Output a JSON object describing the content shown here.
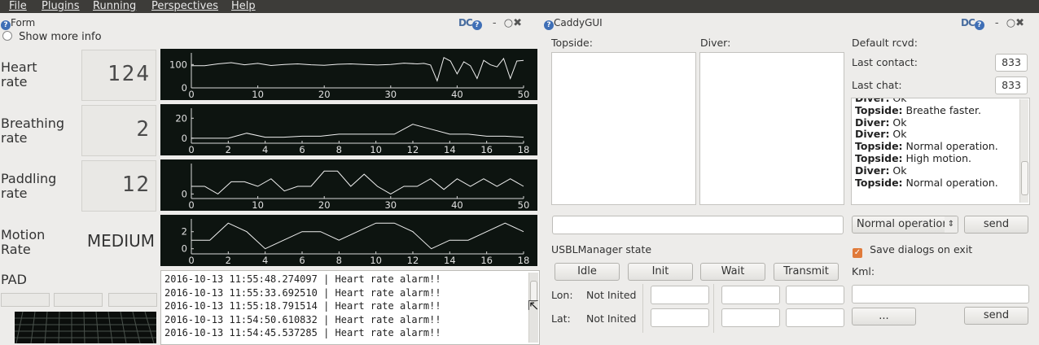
{
  "menu": [
    "File",
    "Plugins",
    "Running",
    "Perspectives",
    "Help"
  ],
  "form": {
    "title": "Form",
    "show_more": "Show more info",
    "rows": [
      {
        "label1": "Heart",
        "label2": "rate",
        "value": "124"
      },
      {
        "label1": "Breathing",
        "label2": "rate",
        "value": "2"
      },
      {
        "label1": "Paddling",
        "label2": "rate",
        "value": "12"
      },
      {
        "label1": "Motion",
        "label2": "Rate",
        "value": "MEDIUM"
      }
    ],
    "pad_label": "PAD",
    "log": [
      "2016-10-13 11:55:48.274097 | Heart rate alarm!!",
      "2016-10-13 11:55:33.692510 | Heart rate alarm!!",
      "2016-10-13 11:55:18.791514 | Heart rate alarm!!",
      "2016-10-13 11:54:50.610832 | Heart rate alarm!!",
      "2016-10-13 11:54:45.537285 | Heart rate alarm!!"
    ]
  },
  "chart_data": [
    {
      "type": "line",
      "name": "heart",
      "xticks": [
        "0",
        "10",
        "20",
        "30",
        "40",
        "50"
      ],
      "yticks": [
        "100",
        "0"
      ],
      "xlim": [
        0,
        50
      ],
      "ylim": [
        0,
        150
      ],
      "x": [
        0,
        2,
        4,
        6,
        8,
        10,
        12,
        14,
        16,
        18,
        20,
        22,
        24,
        26,
        28,
        30,
        32,
        34,
        35,
        36,
        37,
        38,
        39,
        40,
        41,
        42,
        43,
        44,
        45,
        46,
        47,
        48,
        49,
        50
      ],
      "y": [
        95,
        95,
        103,
        108,
        99,
        105,
        96,
        100,
        103,
        99,
        97,
        101,
        103,
        100,
        98,
        100,
        106,
        103,
        105,
        98,
        30,
        130,
        115,
        60,
        112,
        95,
        40,
        118,
        99,
        90,
        126,
        40,
        115,
        118
      ]
    },
    {
      "type": "line",
      "name": "breathing",
      "xticks": [
        "0",
        "2",
        "4",
        "6",
        "8",
        "10",
        "12",
        "14",
        "16",
        "18"
      ],
      "yticks": [
        "20",
        "0"
      ],
      "xlim": [
        0,
        18
      ],
      "ylim": [
        -5,
        30
      ],
      "x": [
        0,
        1,
        2,
        3,
        4,
        5,
        6,
        7,
        8,
        9,
        10,
        11,
        12,
        13,
        14,
        15,
        16,
        17,
        18
      ],
      "y": [
        0,
        0,
        0,
        5,
        1,
        1,
        2,
        2,
        4,
        4,
        4,
        4,
        14,
        9,
        4,
        4,
        2,
        2,
        1
      ]
    },
    {
      "type": "line",
      "name": "paddling",
      "xticks": [
        "0",
        "10",
        "20",
        "30",
        "40",
        "50"
      ],
      "yticks": [
        "0"
      ],
      "xlim": [
        0,
        50
      ],
      "ylim": [
        -3,
        20
      ],
      "x": [
        0,
        2,
        4,
        6,
        8,
        10,
        12,
        14,
        16,
        18,
        20,
        22,
        24,
        26,
        28,
        30,
        32,
        34,
        36,
        38,
        40,
        42,
        44,
        46,
        48,
        50
      ],
      "y": [
        5,
        5,
        0,
        8,
        8,
        5,
        10,
        2,
        5,
        5,
        15,
        15,
        5,
        13,
        5,
        0,
        5,
        5,
        10,
        3,
        10,
        5,
        10,
        5,
        10,
        5
      ],
      "y_base": 0
    },
    {
      "type": "line",
      "name": "motion",
      "xticks": [
        "0",
        "2",
        "4",
        "6",
        "8",
        "10",
        "12",
        "14",
        "16",
        "18"
      ],
      "yticks": [
        "2",
        "0"
      ],
      "xlim": [
        0,
        18
      ],
      "ylim": [
        -0.6,
        3.5
      ],
      "x": [
        0,
        1,
        2,
        3,
        4,
        5,
        6,
        7,
        8,
        9,
        10,
        11,
        12,
        13,
        14,
        15,
        16,
        17,
        18
      ],
      "y": [
        1,
        1,
        3,
        2,
        0,
        1,
        2,
        2,
        1,
        2,
        3,
        3,
        2,
        0,
        1,
        1,
        2,
        3,
        2
      ]
    }
  ],
  "gui": {
    "title": "CaddyGUI",
    "topside_label": "Topside:",
    "diver_label": "Diver:",
    "default_rcvd": "Default rcvd:",
    "last_contact_label": "Last contact:",
    "last_contact_value": "833",
    "last_chat_label": "Last chat:",
    "last_chat_value": "833",
    "chat": [
      {
        "who": "Diver:",
        "msg": " Ok"
      },
      {
        "who": "Topside:",
        "msg": " Breathe faster."
      },
      {
        "who": "Diver:",
        "msg": " Ok"
      },
      {
        "who": "Diver:",
        "msg": " Ok"
      },
      {
        "who": "Topside:",
        "msg": " Normal operation."
      },
      {
        "who": "Topside:",
        "msg": " High motion."
      },
      {
        "who": "Diver:",
        "msg": " Ok"
      },
      {
        "who": "Topside:",
        "msg": " Normal operation."
      }
    ],
    "mode_select": "Normal operation",
    "send_label": "send",
    "usbl_state": "USBLManager state",
    "save_dialogs": "Save dialogs on exit",
    "state_buttons": [
      "Idle",
      "Init",
      "Wait",
      "Transmit"
    ],
    "kml_label": "Kml:",
    "lon_label": "Lon:",
    "lon_value": "Not Inited",
    "lat_label": "Lat:",
    "lat_value": "Not Inited",
    "dots_label": "...",
    "send2_label": "send"
  }
}
